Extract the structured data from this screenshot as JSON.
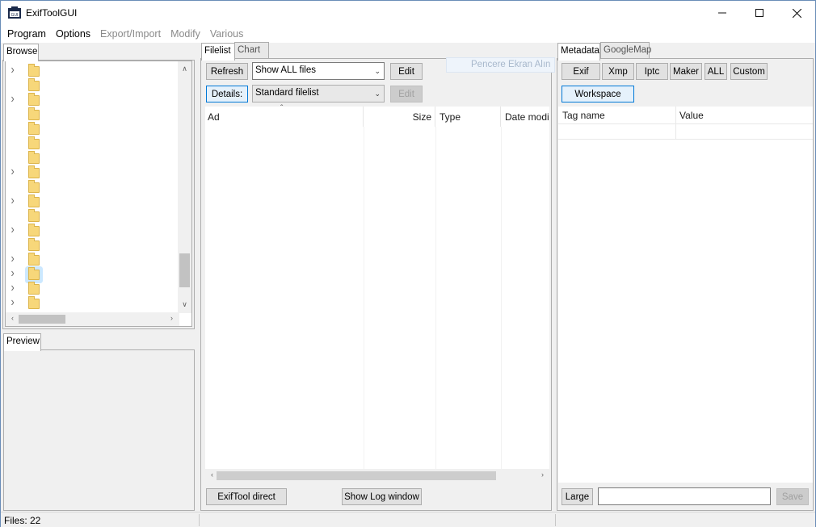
{
  "window": {
    "title": "ExifToolGUI"
  },
  "menu": {
    "items": [
      {
        "label": "Program",
        "enabled": true
      },
      {
        "label": "Options",
        "enabled": true
      },
      {
        "label": "Export/Import",
        "enabled": false
      },
      {
        "label": "Modify",
        "enabled": false
      },
      {
        "label": "Various",
        "enabled": false
      }
    ]
  },
  "left": {
    "browse_tab": "Browse",
    "preview_tab": "Preview",
    "tree": [
      {
        "expandable": true
      },
      {
        "expandable": false
      },
      {
        "expandable": true
      },
      {
        "expandable": false
      },
      {
        "expandable": false
      },
      {
        "expandable": false
      },
      {
        "expandable": false
      },
      {
        "expandable": true
      },
      {
        "expandable": false
      },
      {
        "expandable": true
      },
      {
        "expandable": false
      },
      {
        "expandable": true
      },
      {
        "expandable": false
      },
      {
        "expandable": true
      },
      {
        "expandable": true,
        "selected": true
      },
      {
        "expandable": true
      },
      {
        "expandable": true
      }
    ]
  },
  "middle": {
    "tabs": [
      "Filelist",
      "Chart"
    ],
    "refresh_label": "Refresh",
    "filter_value": "Show ALL files",
    "edit_label": "Edit",
    "details_label": "Details:",
    "view_value": "Standard filelist",
    "edit2_label": "Edit",
    "columns": [
      "Ad",
      "Size",
      "Type",
      "Date modi"
    ],
    "exiftool_label": "ExifTool direct",
    "log_label": "Show Log window",
    "ghost_text": "Pencere Ekran Alın"
  },
  "right": {
    "tabs": [
      "Metadata",
      "GoogleMap"
    ],
    "buttons": [
      "Exif",
      "Xmp",
      "Iptc",
      "Maker",
      "ALL",
      "Custom"
    ],
    "workspace_label": "Workspace",
    "columns": [
      "Tag name",
      "Value"
    ],
    "large_label": "Large",
    "save_label": "Save",
    "value_input": ""
  },
  "status": {
    "files": "Files: 22"
  }
}
